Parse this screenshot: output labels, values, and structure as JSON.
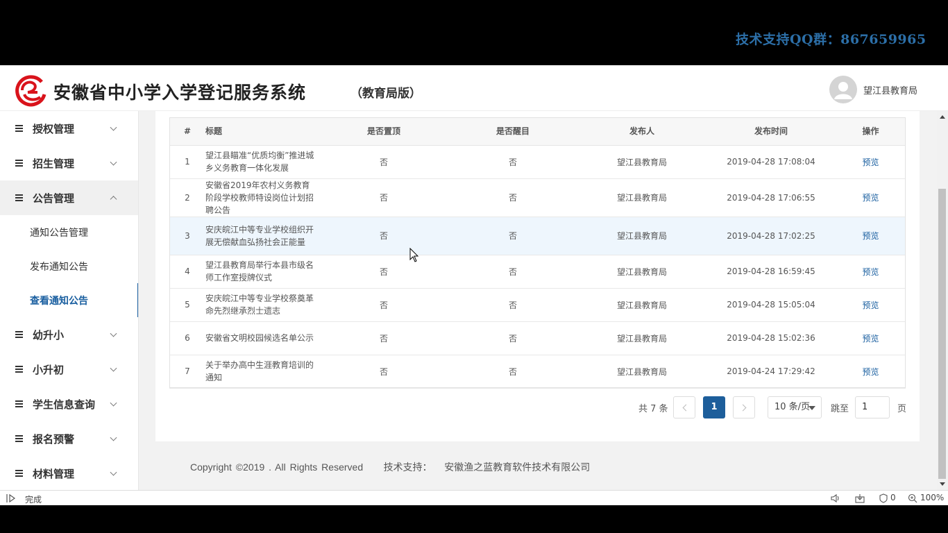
{
  "banner": {
    "support_text": "技术支持QQ群：867659965"
  },
  "header": {
    "title": "安徽省中小学入学登记服务系统",
    "edition": "（教育局版）",
    "user_name": "望江县教育局",
    "brand_color": "#d9131b"
  },
  "sidebar": {
    "groups": [
      {
        "label": "授权管理"
      },
      {
        "label": "招生管理"
      },
      {
        "label": "公告管理",
        "sub_items": [
          "通知公告管理",
          "发布通知公告",
          "查看通知公告"
        ]
      },
      {
        "label": "幼升小"
      },
      {
        "label": "小升初"
      },
      {
        "label": "学生信息查询"
      },
      {
        "label": "报名预警"
      },
      {
        "label": "材料管理"
      }
    ],
    "active_item": "查看通知公告"
  },
  "table": {
    "headers": [
      "#",
      "标题",
      "是否置顶",
      "是否醒目",
      "发布人",
      "发布时间",
      "操作"
    ],
    "rows": [
      {
        "no": "1",
        "title": "望江县瞄准“优质均衡”推进城乡义务教育一体化发展",
        "top": "否",
        "highlight": "否",
        "publisher": "望江县教育局",
        "time": "2019-04-28 17:08:04",
        "action": "预览"
      },
      {
        "no": "2",
        "title": "安徽省2019年农村义务教育阶段学校教师特设岗位计划招聘公告",
        "top": "否",
        "highlight": "否",
        "publisher": "望江县教育局",
        "time": "2019-04-28 17:06:55",
        "action": "预览"
      },
      {
        "no": "3",
        "title": "安庆皖江中等专业学校组织开展无偿献血弘扬社会正能量",
        "top": "否",
        "highlight": "否",
        "publisher": "望江县教育局",
        "time": "2019-04-28 17:02:25",
        "action": "预览"
      },
      {
        "no": "4",
        "title": "望江县教育局举行本县市级名师工作室授牌仪式",
        "top": "否",
        "highlight": "否",
        "publisher": "望江县教育局",
        "time": "2019-04-28 16:59:45",
        "action": "预览"
      },
      {
        "no": "5",
        "title": "安庆皖江中等专业学校祭奠革命先烈继承烈士遗志",
        "top": "否",
        "highlight": "否",
        "publisher": "望江县教育局",
        "time": "2019-04-28 15:05:04",
        "action": "预览"
      },
      {
        "no": "6",
        "title": "安徽省文明校园候选名单公示",
        "top": "否",
        "highlight": "否",
        "publisher": "望江县教育局",
        "time": "2019-04-28 15:02:36",
        "action": "预览"
      },
      {
        "no": "7",
        "title": "关于举办高中生涯教育培训的通知",
        "top": "否",
        "highlight": "否",
        "publisher": "望江县教育局",
        "time": "2019-04-24 17:29:42",
        "action": "预览"
      }
    ]
  },
  "pagination": {
    "total": "共 7 条",
    "current_page": "1",
    "page_size": "10 条/页",
    "jump_label": "跳至",
    "jump_value": "1",
    "page_unit": "页"
  },
  "footer": {
    "copyright": "Copyright ©2019 . All Rights Reserved",
    "support_label": "技术支持：",
    "company": "安徽渔之蓝教育软件技术有限公司"
  },
  "statusbar": {
    "status": "完成",
    "counter": "0",
    "zoom": "100%"
  },
  "colors": {
    "accent": "#1d5e9b",
    "highlight_row": "#eef6fd"
  }
}
